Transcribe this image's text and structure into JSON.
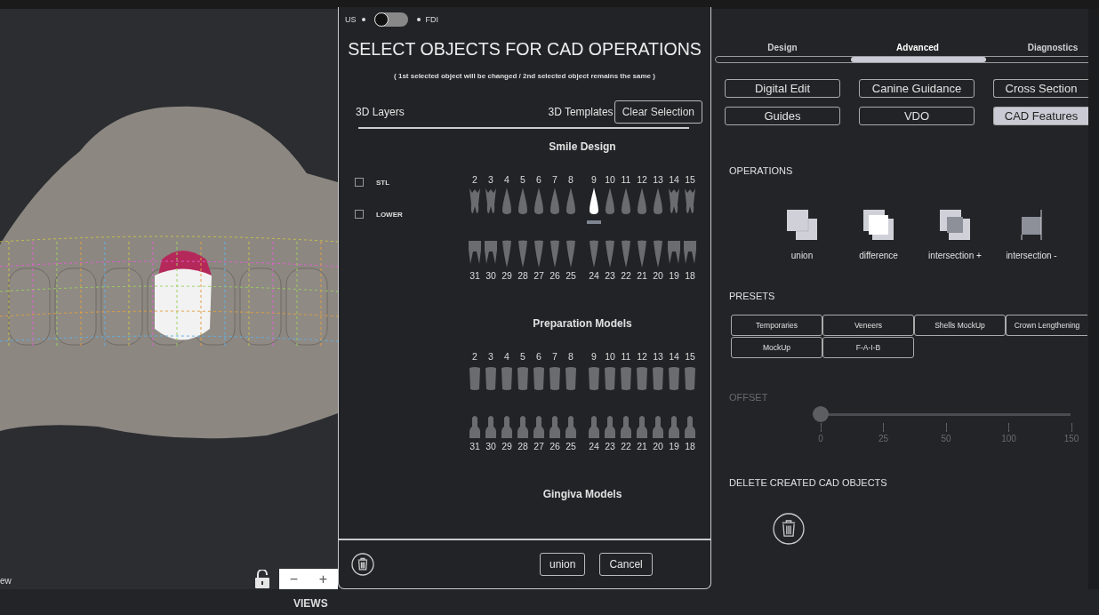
{
  "viewport": {
    "label": "ew",
    "zoom_out": "−",
    "zoom_in": "+",
    "views_label": "VIEWS"
  },
  "modal": {
    "toggle": {
      "left": "US",
      "right": "FDI",
      "on": false
    },
    "title": "SELECT OBJECTS FOR CAD OPERATIONS",
    "subtitle": "( 1st selected object will be changed / 2nd selected object remains the same )",
    "tabs": [
      "3D Layers",
      "3D Templates"
    ],
    "clear_button": "Clear Selection",
    "layers": [
      {
        "label": "STL",
        "checked": false
      },
      {
        "label": "LOWER",
        "checked": false
      }
    ],
    "sections": [
      {
        "title": "Smile Design",
        "kind": "natural",
        "upper": [
          {
            "number": "2",
            "selected": false
          },
          {
            "number": "3",
            "selected": false
          },
          {
            "number": "4",
            "selected": false
          },
          {
            "number": "5",
            "selected": false
          },
          {
            "number": "6",
            "selected": false
          },
          {
            "number": "7",
            "selected": false
          },
          {
            "number": "8",
            "selected": false
          },
          {
            "number": "9",
            "selected": true
          },
          {
            "number": "10",
            "selected": false
          },
          {
            "number": "11",
            "selected": false
          },
          {
            "number": "12",
            "selected": false
          },
          {
            "number": "13",
            "selected": false
          },
          {
            "number": "14",
            "selected": false
          },
          {
            "number": "15",
            "selected": false
          }
        ],
        "lower": [
          {
            "number": "31",
            "selected": false
          },
          {
            "number": "30",
            "selected": false
          },
          {
            "number": "29",
            "selected": false
          },
          {
            "number": "28",
            "selected": false
          },
          {
            "number": "27",
            "selected": false
          },
          {
            "number": "26",
            "selected": false
          },
          {
            "number": "25",
            "selected": false
          },
          {
            "number": "24",
            "selected": false
          },
          {
            "number": "23",
            "selected": false
          },
          {
            "number": "22",
            "selected": false
          },
          {
            "number": "21",
            "selected": false
          },
          {
            "number": "20",
            "selected": false
          },
          {
            "number": "19",
            "selected": false
          },
          {
            "number": "18",
            "selected": false
          }
        ]
      },
      {
        "title": "Preparation Models",
        "kind": "prep",
        "upper": [
          {
            "number": "2",
            "selected": false
          },
          {
            "number": "3",
            "selected": false
          },
          {
            "number": "4",
            "selected": false
          },
          {
            "number": "5",
            "selected": false
          },
          {
            "number": "6",
            "selected": false
          },
          {
            "number": "7",
            "selected": false
          },
          {
            "number": "8",
            "selected": false
          },
          {
            "number": "9",
            "selected": false
          },
          {
            "number": "10",
            "selected": false
          },
          {
            "number": "11",
            "selected": false
          },
          {
            "number": "12",
            "selected": false
          },
          {
            "number": "13",
            "selected": false
          },
          {
            "number": "14",
            "selected": false
          },
          {
            "number": "15",
            "selected": false
          }
        ],
        "lower": [
          {
            "number": "31",
            "selected": false
          },
          {
            "number": "30",
            "selected": false
          },
          {
            "number": "29",
            "selected": false
          },
          {
            "number": "28",
            "selected": false
          },
          {
            "number": "27",
            "selected": false
          },
          {
            "number": "26",
            "selected": false
          },
          {
            "number": "25",
            "selected": false
          },
          {
            "number": "24",
            "selected": false
          },
          {
            "number": "23",
            "selected": false
          },
          {
            "number": "22",
            "selected": false
          },
          {
            "number": "21",
            "selected": false
          },
          {
            "number": "20",
            "selected": false
          },
          {
            "number": "19",
            "selected": false
          },
          {
            "number": "18",
            "selected": false
          }
        ]
      },
      {
        "title": "Gingiva Models",
        "kind": "gingiva"
      }
    ],
    "footer_buttons": [
      "union",
      "Cancel"
    ]
  },
  "panel": {
    "tabs": [
      {
        "label": "Design",
        "selected": false
      },
      {
        "label": "Advanced",
        "selected": true
      },
      {
        "label": "Diagnostics",
        "selected": false
      }
    ],
    "features": [
      {
        "label": "Digital Edit",
        "selected": false
      },
      {
        "label": "Canine Guidance",
        "selected": false
      },
      {
        "label": "Cross Section",
        "selected": false
      },
      {
        "label": "Guides",
        "selected": false
      },
      {
        "label": "VDO",
        "selected": false
      },
      {
        "label": "CAD Features",
        "selected": true
      }
    ],
    "operations_title": "OPERATIONS",
    "operations": [
      {
        "label": "union",
        "kind": "union"
      },
      {
        "label": "difference",
        "kind": "difference"
      },
      {
        "label": "intersection +",
        "kind": "intersect_plus"
      },
      {
        "label": "intersection -",
        "kind": "intersect_minus"
      }
    ],
    "presets_title": "PRESETS",
    "presets": [
      "Temporaries",
      "Veneers",
      "Shells MockUp",
      "Crown Lengthening",
      "MockUp",
      "F-A-I-B"
    ],
    "offset": {
      "title": "OFFSET",
      "disabled": true,
      "level": 0,
      "ticks": [
        "0",
        "25",
        "50",
        "100",
        "150"
      ]
    },
    "delete_title": "DELETE CREATED CAD OBJECTS"
  }
}
